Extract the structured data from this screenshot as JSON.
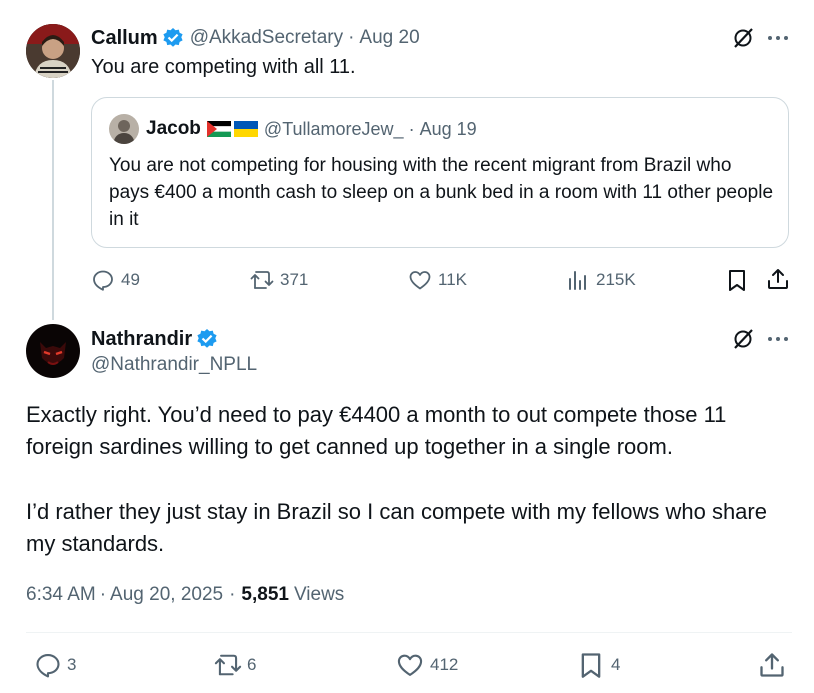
{
  "tweet1": {
    "name": "Callum",
    "handle": "@AkkadSecretary",
    "sep": "·",
    "date": "Aug 20",
    "text": "You are competing with all 11.",
    "actions": {
      "replies": "49",
      "retweets": "371",
      "likes": "11K",
      "views": "215K"
    }
  },
  "quote": {
    "name": "Jacob",
    "handle": "@TullamoreJew_",
    "sep": "·",
    "date": "Aug 19",
    "text": "You are not competing for housing with the recent migrant from Brazil who pays €400 a month cash to sleep on a bunk bed in a room with 11 other people in it"
  },
  "tweet2": {
    "name": "Nathrandir",
    "handle": "@Nathrandir_NPLL",
    "paragraph1": "Exactly right. You’d need to pay €4400 a month to out compete those 11 foreign sardines willing to get canned up together in a single room.",
    "paragraph2": "I’d rather they just stay in Brazil so I can compete with my fellows who share my standards.",
    "time": "6:34 AM",
    "sep1": "·",
    "date": "Aug 20, 2025",
    "sep2": "·",
    "views_count": "5,851",
    "views_label": "Views",
    "actions": {
      "replies": "3",
      "retweets": "6",
      "likes": "412",
      "bookmarks": "4"
    }
  },
  "colors": {
    "verified": "#1d9bf0",
    "muted": "#536471",
    "border": "#cfd9de"
  }
}
